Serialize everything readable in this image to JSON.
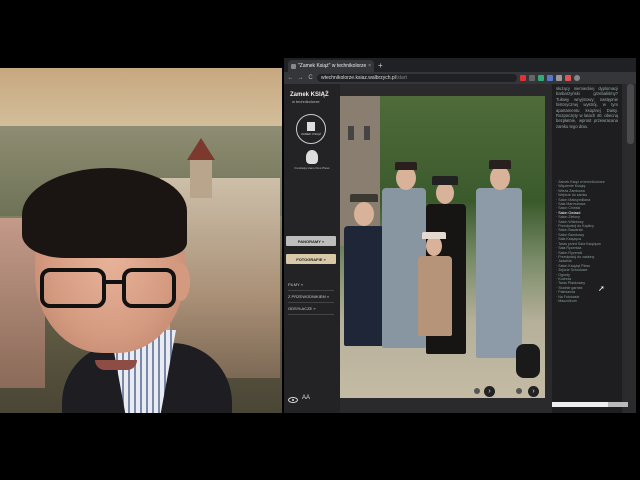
{
  "browser": {
    "tab_title": "\"Zamek Książ\" w technikolorze",
    "tab_close": "×",
    "new_tab": "+",
    "url_host": "wtechnikolorze.ksiaz.walbrzych.pl",
    "url_path": "/start",
    "nav_back": "←",
    "nav_forward": "→",
    "nav_reload": "C",
    "colors": {
      "frame": "#202124",
      "toolbar": "#35363a"
    }
  },
  "site": {
    "title": "Zamek KSIĄŻ",
    "subtitle": "w technikolorze",
    "seal_text": "ZAMEK KSIĄŻ",
    "foundation_text": "Fundacja Hans Kłos Pless",
    "menu_panoramy": "PANORAMY »",
    "menu_fotografie": "FOTOGRAFIE »",
    "menu_filmy": "FILMY »",
    "menu_przewodnik": "Z PRZEWODNIKIEM »",
    "menu_odsyłacz": "ODSYŁACZE »",
    "font_toggle": "AA",
    "accent_color": "#d9c9a8"
  },
  "article": {
    "paragraph": "służący niemieckiej dyplomacji barbarzyński grzebaliśmy? Tułowy wnyjmowy; następnie historycznej wystrój, w tym apartamentu książnej Daisy. Rozpoczęty w latach 40. obecną bezpłatnie, wprost przewracana zamku tego dnia.",
    "toc": [
      "Zamek Książ w technikolorze",
      "Więzienie Książę",
      "Wieża Zamkowa",
      "Wejście do zamku",
      "Salon Maksymiliana",
      "Sala Marmurowa",
      "Salon Chiński",
      "Salon Gwiazd",
      "Salon Zielony",
      "Salon Wiśniowy",
      "Przedpokój do Kaplicy",
      "Salon Bawarski",
      "Salon Barokowy",
      "Sala Książęca",
      "Taras przed Sala Książęca",
      "Sala Rycerska",
      "Salon Rycerski",
      "Przedpokój do zasłony",
      "Jadalnia",
      "Salon Książąt Pless",
      "Zejście Schodowe",
      "Ogrody",
      "Kuchnia",
      "Taras Płaskowny",
      "Studnie garnek",
      "Palmiarnia",
      "Na Fotokasie",
      "Mauzoleum"
    ],
    "toc_current_index": 7
  },
  "photo": {
    "prev_arrow": "›",
    "next_arrow": "›"
  }
}
